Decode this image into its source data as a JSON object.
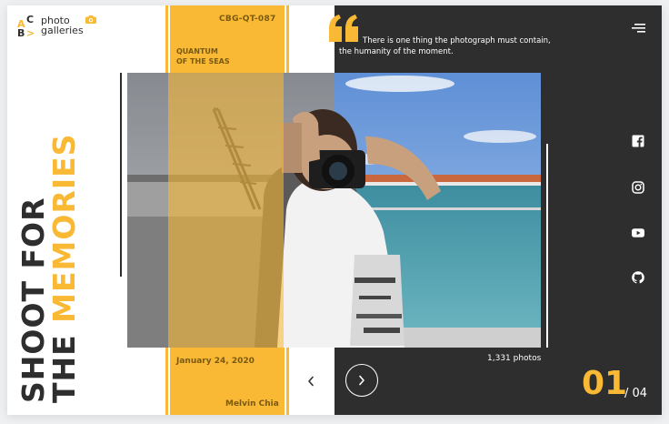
{
  "brand": {
    "letters": [
      "A",
      "C",
      "B",
      ">"
    ],
    "name_line1": "photo",
    "name_line2": "galleries",
    "camera_icon": "camera-icon",
    "accent_color": "#f9b934",
    "dark_color": "#2e2e2e"
  },
  "hero": {
    "title_line1": "SHOOT FOR",
    "title_line2_prefix": "THE ",
    "title_line2_highlight": "MEMORIES"
  },
  "strip": {
    "code": "CBG-QT-087",
    "ship_line1": "QUANTUM",
    "ship_line2": "OF THE SEAS",
    "date": "January 24, 2020",
    "author": "Melvin Chia"
  },
  "quote": {
    "text": "There is one thing the photograph must contain, the humanity of the moment."
  },
  "gallery": {
    "photo_count": "1,331 photos",
    "current": "01",
    "total": "/ 04",
    "prev_icon": "chevron-left-icon",
    "next_icon": "chevron-right-icon"
  },
  "nav": {
    "menu_icon": "menu-icon"
  },
  "social": [
    {
      "name": "facebook",
      "icon": "facebook-icon"
    },
    {
      "name": "instagram",
      "icon": "instagram-icon"
    },
    {
      "name": "youtube",
      "icon": "youtube-icon"
    },
    {
      "name": "github",
      "icon": "github-icon"
    }
  ]
}
